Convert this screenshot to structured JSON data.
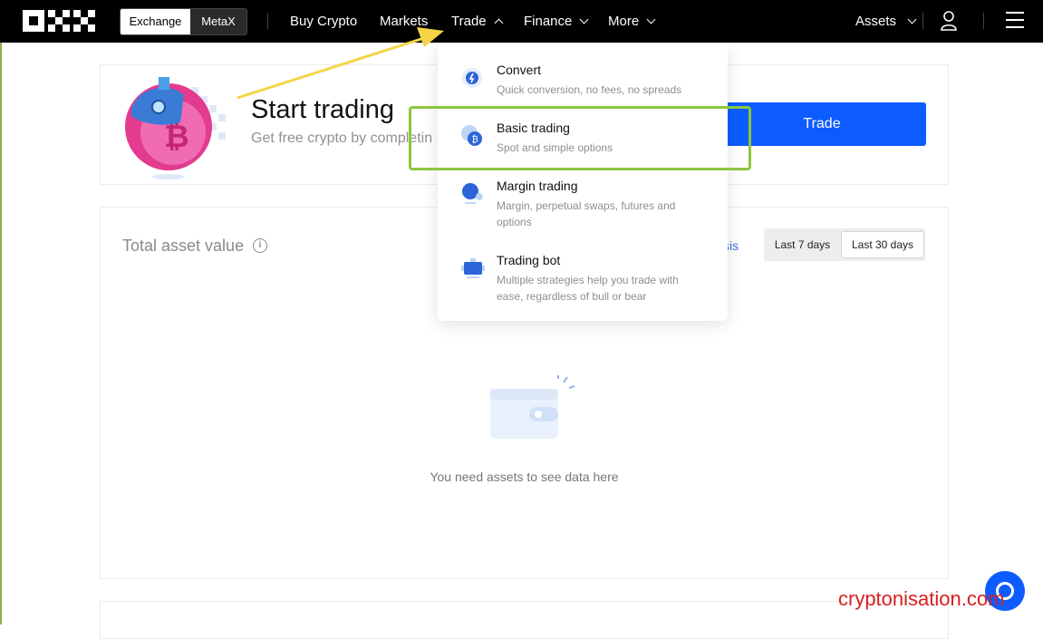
{
  "topbar": {
    "switch": {
      "exchange": "Exchange",
      "metax": "MetaX"
    },
    "nav": {
      "buy_crypto": "Buy Crypto",
      "markets": "Markets",
      "trade": "Trade",
      "finance": "Finance",
      "more": "More",
      "assets": "Assets"
    }
  },
  "hero": {
    "title": "Start trading",
    "subtitle": "Get free crypto by completin",
    "trade_button": "Trade"
  },
  "assets_card": {
    "title": "Total asset value",
    "analysis_link": "ysis",
    "ranges": [
      "Last 7 days",
      "Last 30 days"
    ],
    "empty_text": "You need assets to see data here"
  },
  "trade_menu": {
    "items": [
      {
        "title": "Convert",
        "desc": "Quick conversion, no fees, no spreads",
        "icon": "convert-icon"
      },
      {
        "title": "Basic trading",
        "desc": "Spot and simple options",
        "icon": "bitcoin-coins-icon"
      },
      {
        "title": "Margin trading",
        "desc": "Margin, perpetual swaps, futures and options",
        "icon": "margin-icon"
      },
      {
        "title": "Trading bot",
        "desc": "Multiple strategies help you trade with ease, regardless of bull or bear",
        "icon": "robot-icon"
      }
    ]
  },
  "watermark": "cryptonisation.com",
  "colors": {
    "brand_blue": "#0c5cff",
    "highlight_green": "#8cc63f",
    "annotation_yellow": "#f5d547"
  }
}
